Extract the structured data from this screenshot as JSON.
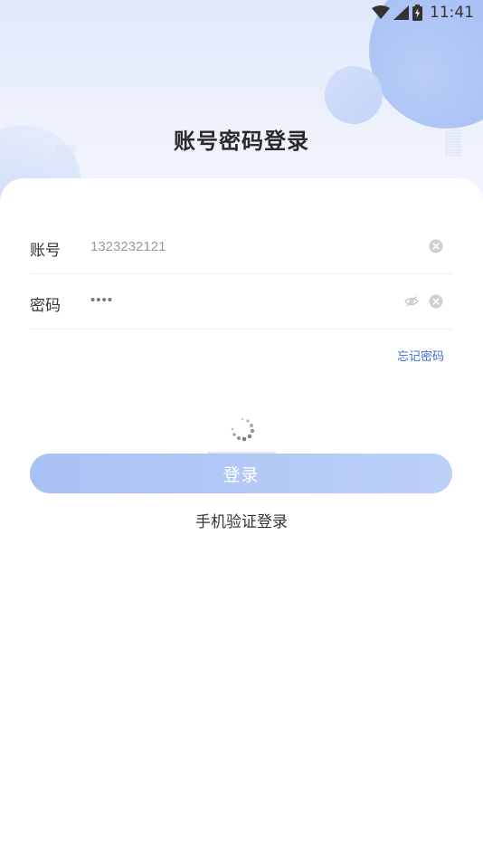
{
  "status_bar": {
    "time": "11:41",
    "icons": [
      "wifi-icon",
      "signal-icon",
      "battery-charging-icon"
    ]
  },
  "page": {
    "title": "账号密码登录"
  },
  "form": {
    "account": {
      "label": "账号",
      "value": "1323232121"
    },
    "password": {
      "label": "密码",
      "value": "••••"
    },
    "forgot_password": "忘记密码",
    "login_button": "登录",
    "sms_login": "手机验证登录"
  },
  "colors": {
    "accent": "#3a6fd8",
    "button_start": "#a9c1f4",
    "button_end": "#bcd0f8",
    "bg_circle": "#a9c1f4"
  }
}
